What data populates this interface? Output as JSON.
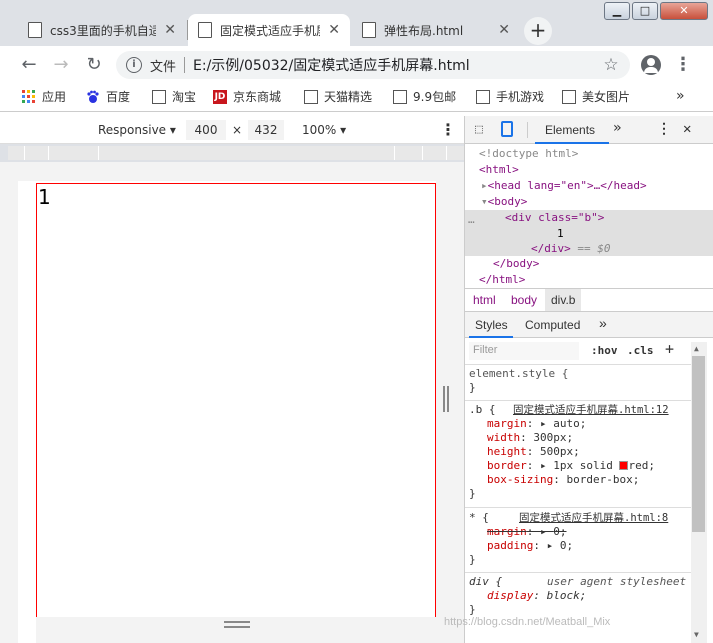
{
  "tabs": [
    {
      "title": "css3里面的手机自适"
    },
    {
      "title": "固定模式适应手机屏"
    },
    {
      "title": "弹性布局.html"
    }
  ],
  "address": {
    "file_label": "文件",
    "url": "E:/示例/05032/固定模式适应手机屏幕.html"
  },
  "bookmarks": [
    {
      "label": "应用",
      "icon": "apps-icon"
    },
    {
      "label": "百度",
      "icon": "baidu-icon"
    },
    {
      "label": "淘宝",
      "icon": "page-icon"
    },
    {
      "label": "京东商城",
      "icon": "jd-icon",
      "badge": "JD"
    },
    {
      "label": "天猫精选",
      "icon": "page-icon"
    },
    {
      "label": "9.9包邮",
      "icon": "page-icon"
    },
    {
      "label": "手机游戏",
      "icon": "page-icon"
    },
    {
      "label": "美女图片",
      "icon": "page-icon"
    }
  ],
  "device": {
    "mode": "Responsive",
    "width": "400",
    "times": "×",
    "height": "432",
    "zoom": "100%"
  },
  "page": {
    "content": "1"
  },
  "devtools": {
    "tab": "Elements",
    "dom": {
      "doctype": "<!doctype html>",
      "html_open": "<html>",
      "head": "<head lang=\"en\">…</head>",
      "body_open": "<body>",
      "div_open": "<div class=\"b\">",
      "div_text": "1",
      "div_close": "</div>",
      "selected_marker": "== $0",
      "body_close": "</body>",
      "html_close": "</html>"
    },
    "breadcrumbs": [
      "html",
      "body",
      "div.b"
    ],
    "style_tabs": [
      "Styles",
      "Computed"
    ],
    "filter_placeholder": "Filter",
    "hov": ":hov",
    "cls": ".cls",
    "rules": {
      "element_style": "element.style {",
      "close": "}",
      "b_selector": ".b {",
      "b_source": "固定模式适应手机屏幕.html:12",
      "b_props": [
        [
          "margin",
          "auto;"
        ],
        [
          "width",
          "300px;"
        ],
        [
          "height",
          "500px;"
        ],
        [
          "border",
          "1px solid ",
          "red;"
        ],
        [
          "box-sizing",
          "border-box;"
        ]
      ],
      "star_selector": "* {",
      "star_source": "固定模式适应手机屏幕.html:8",
      "star_props": [
        [
          "margin",
          "0;"
        ],
        [
          "padding",
          "0;"
        ]
      ],
      "div_selector": "div {",
      "div_source": "user agent stylesheet",
      "div_props": [
        [
          "display",
          "block;"
        ]
      ]
    },
    "border_color": "#ff0000"
  },
  "watermark": "https://blog.csdn.net/Meatball_Mix"
}
